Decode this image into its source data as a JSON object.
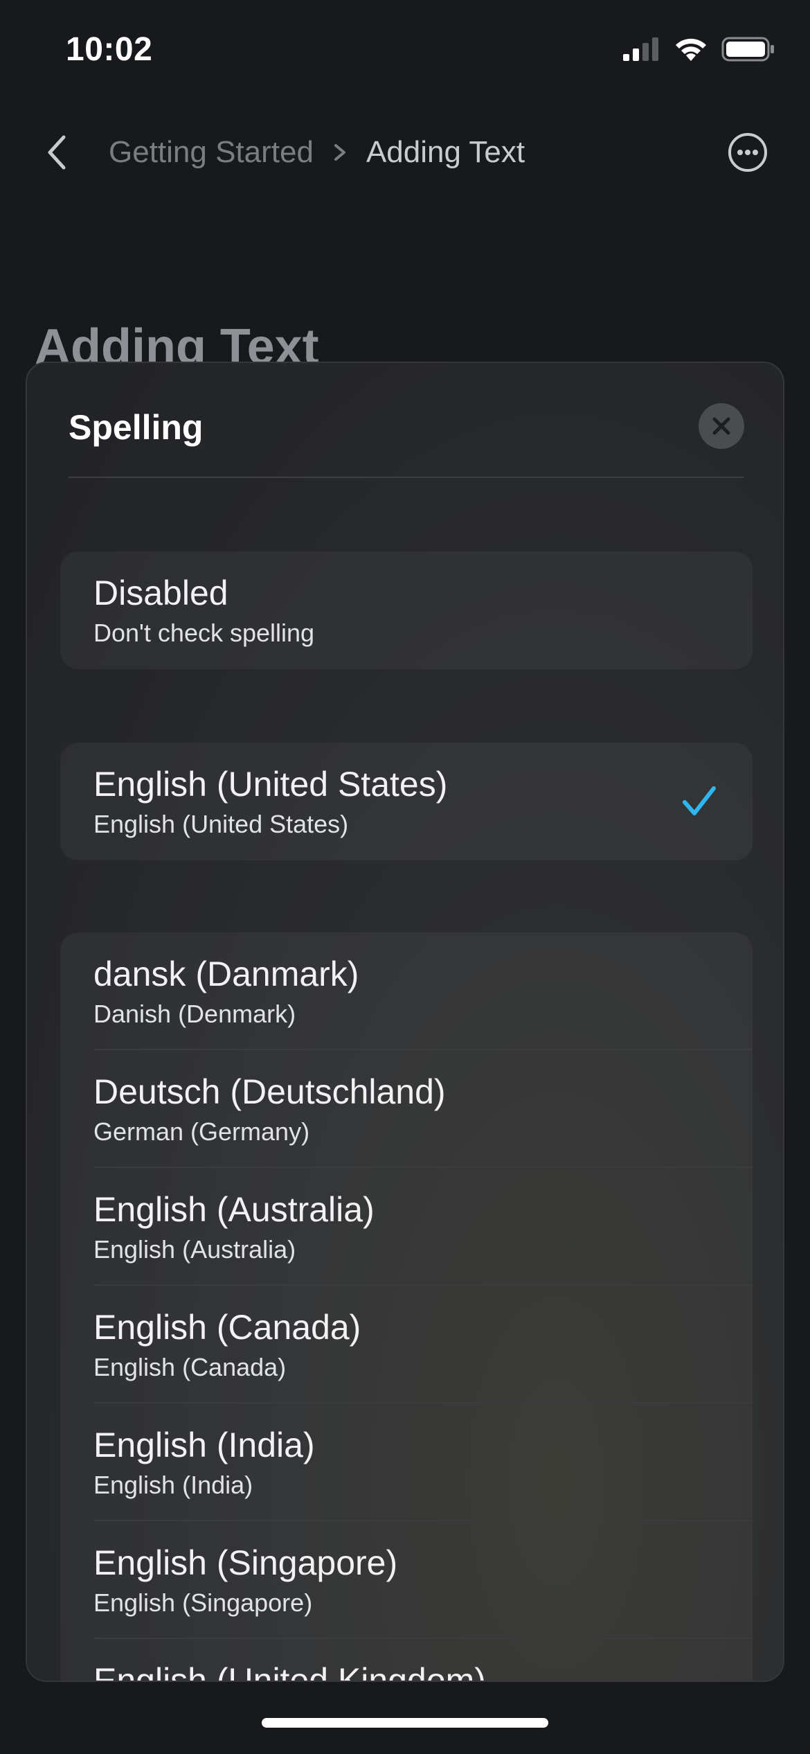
{
  "status_bar": {
    "time": "10:02"
  },
  "nav": {
    "breadcrumb_parent": "Getting Started",
    "breadcrumb_current": "Adding Text"
  },
  "page": {
    "title": "Adding Text"
  },
  "sheet": {
    "title": "Spelling",
    "disabled_option": {
      "title": "Disabled",
      "subtitle": "Don't check spelling"
    },
    "selected_option": {
      "title": "English (United States)",
      "subtitle": "English (United States)",
      "checked": true
    },
    "languages": [
      {
        "title": "dansk (Danmark)",
        "subtitle": "Danish (Denmark)"
      },
      {
        "title": "Deutsch (Deutschland)",
        "subtitle": "German (Germany)"
      },
      {
        "title": "English (Australia)",
        "subtitle": "English (Australia)"
      },
      {
        "title": "English (Canada)",
        "subtitle": "English (Canada)"
      },
      {
        "title": "English (India)",
        "subtitle": "English (India)"
      },
      {
        "title": "English (Singapore)",
        "subtitle": "English (Singapore)"
      },
      {
        "title": "English (United Kingdom)",
        "subtitle": ""
      }
    ]
  },
  "colors": {
    "accent": "#2fb5f0",
    "background": "#17191c",
    "sheet": "#2a2b2e"
  }
}
